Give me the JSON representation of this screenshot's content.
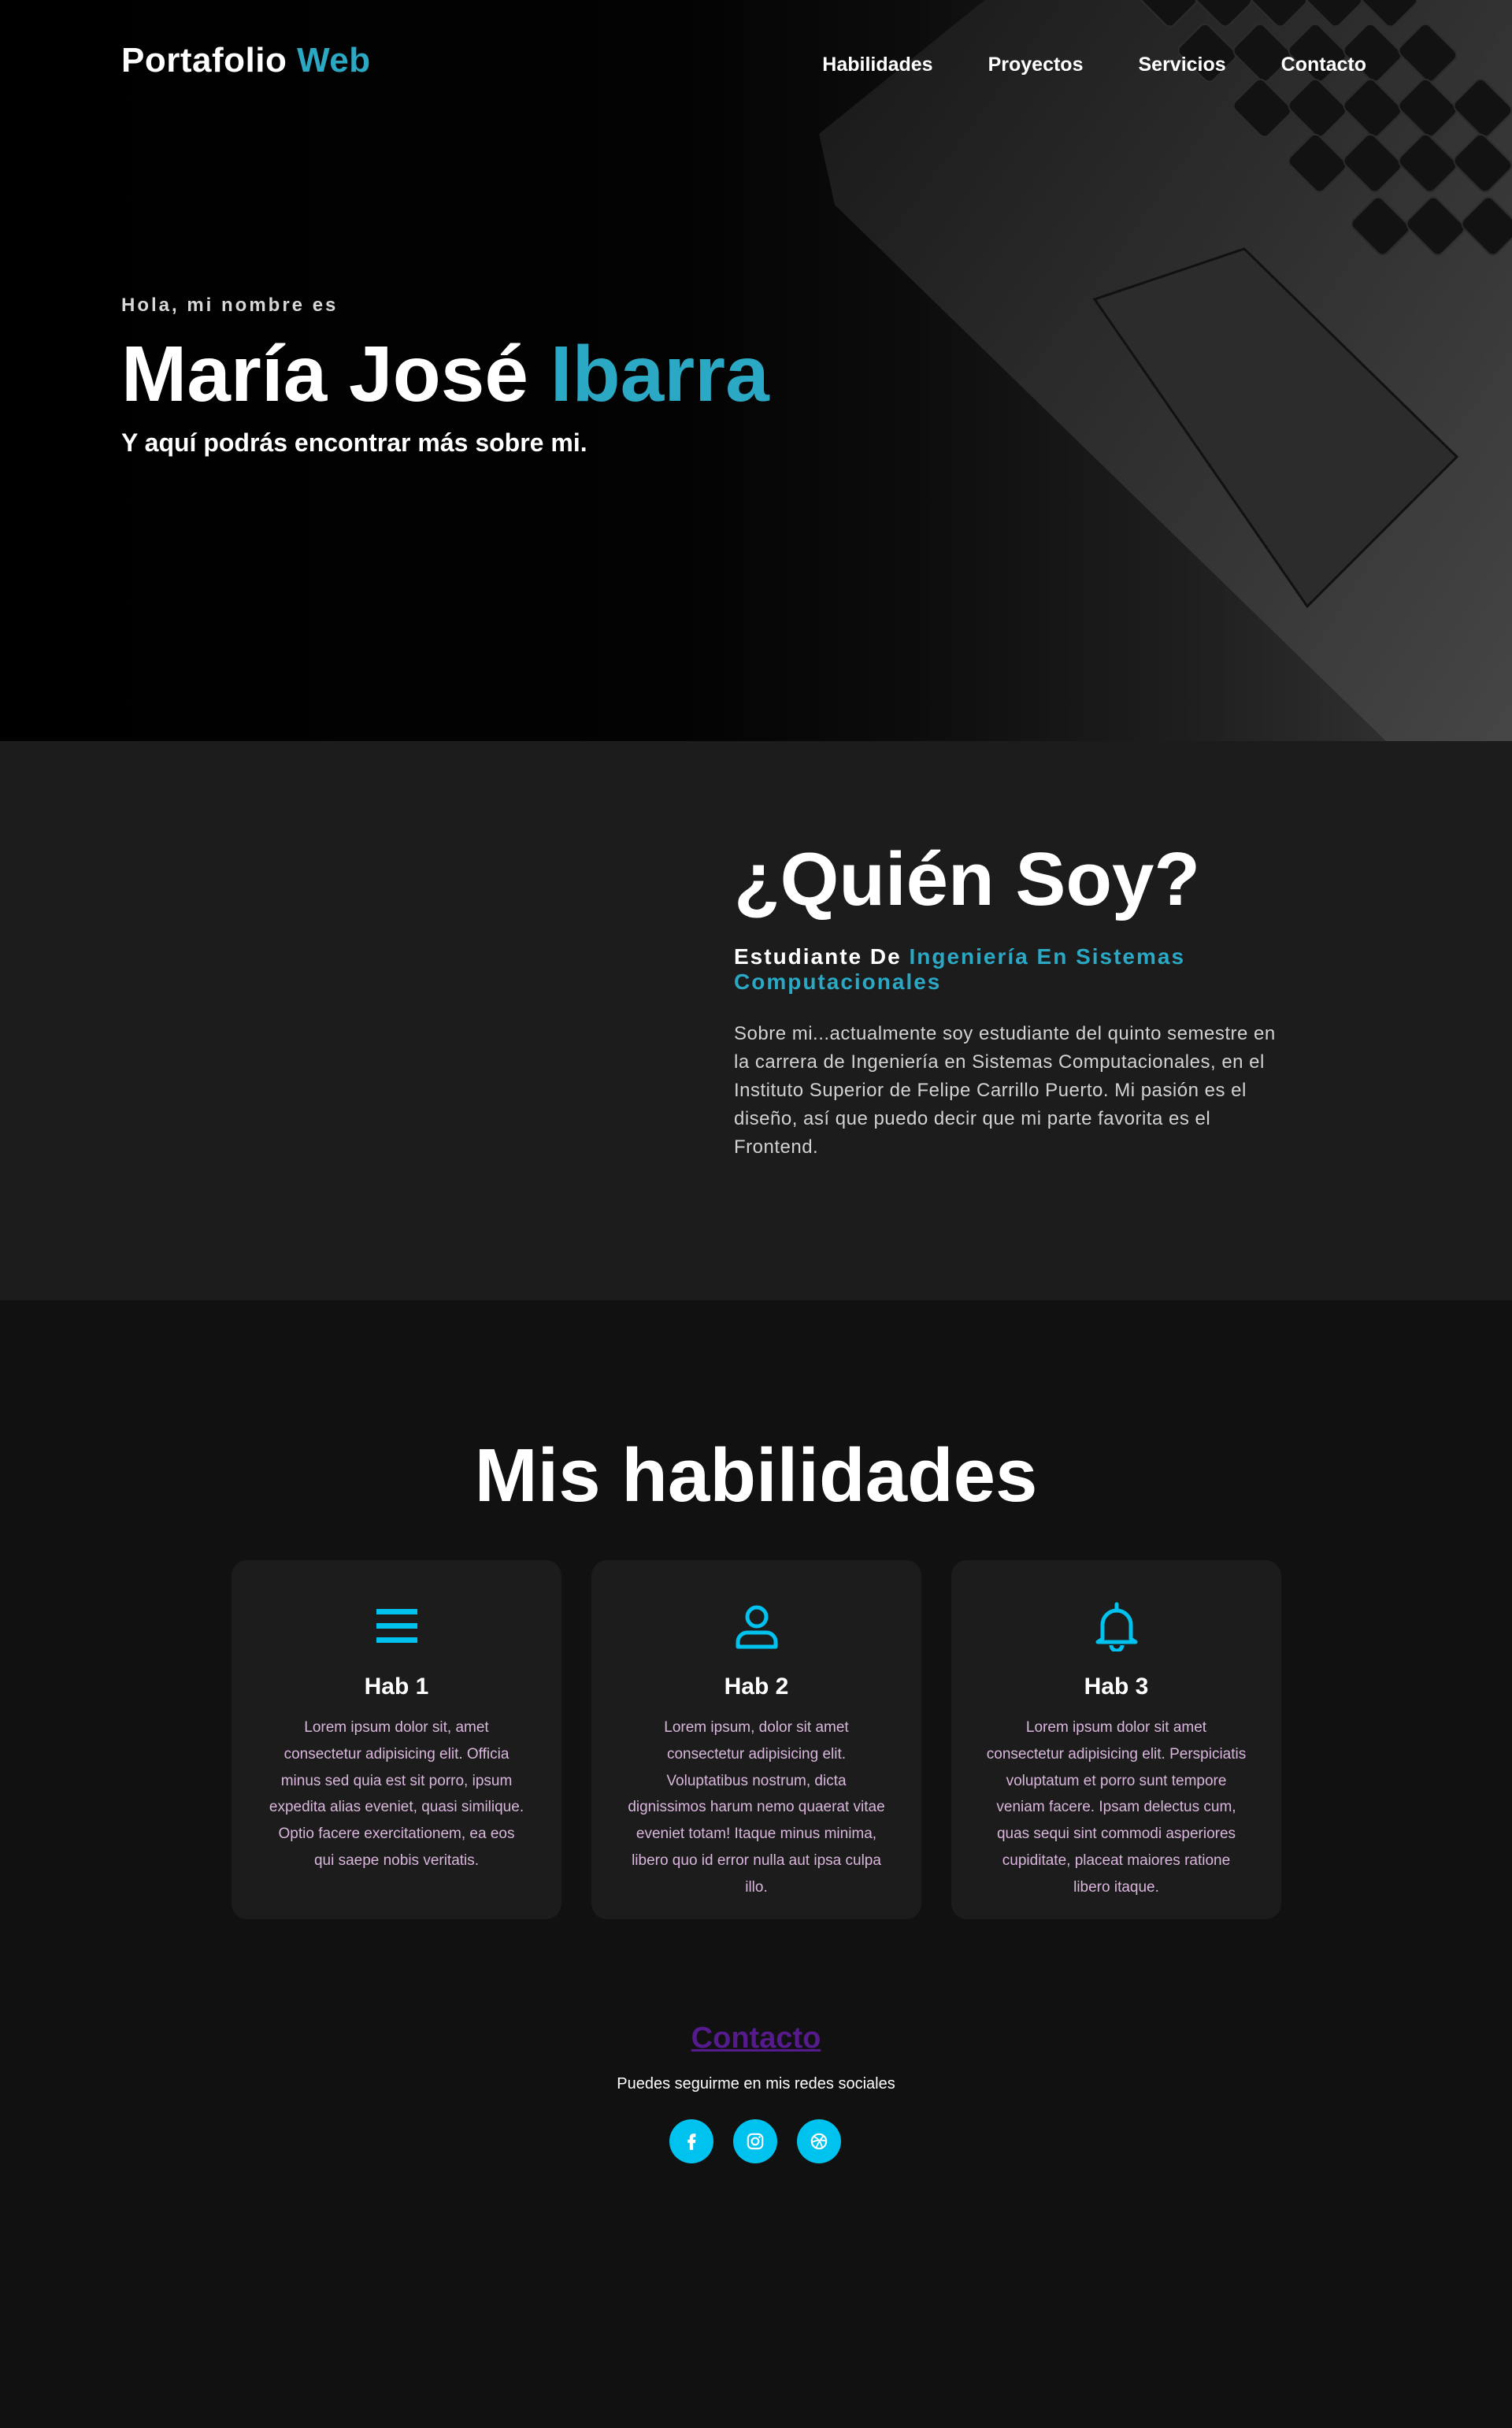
{
  "header": {
    "logo_text": "Portafolio",
    "logo_accent": "Web",
    "nav": [
      "Habilidades",
      "Proyectos",
      "Servicios",
      "Contacto"
    ]
  },
  "hero": {
    "greeting": "Hola, mi nombre es",
    "name_first": "María José",
    "name_accent": "Ibarra",
    "tagline": "Y aquí podrás encontrar más sobre mi."
  },
  "about": {
    "title": "¿Quién Soy?",
    "subtitle_prefix": "Estudiante De",
    "subtitle_accent": "Ingeniería En Sistemas Computacionales",
    "text": "Sobre mi...actualmente soy estudiante del quinto semestre en la carrera de Ingeniería en Sistemas Computacionales, en el Instituto Superior de Felipe Carrillo Puerto. Mi pasión es el diseño, así que puedo decir que mi parte favorita es el Frontend."
  },
  "skills": {
    "title": "Mis habilidades",
    "cards": [
      {
        "icon": "menu-icon",
        "title": "Hab 1",
        "text": "Lorem ipsum dolor sit, amet consectetur adipisicing elit. Officia minus sed quia est sit porro, ipsum expedita alias eveniet, quasi similique. Optio facere exercitationem, ea eos qui saepe nobis veritatis."
      },
      {
        "icon": "user-icon",
        "title": "Hab 2",
        "text": "Lorem ipsum, dolor sit amet consectetur adipisicing elit. Voluptatibus nostrum, dicta dignissimos harum nemo quaerat vitae eveniet totam! Itaque minus minima, libero quo id error nulla aut ipsa culpa illo."
      },
      {
        "icon": "bell-icon",
        "title": "Hab 3",
        "text": "Lorem ipsum dolor sit amet consectetur adipisicing elit. Perspiciatis voluptatum et porro sunt tempore veniam facere. Ipsam delectus cum, quas sequi sint commodi asperiores cupiditate, placeat maiores ratione libero itaque."
      }
    ]
  },
  "contact": {
    "title": "Contacto",
    "subtitle": "Puedes seguirme en mis redes sociales",
    "socials": [
      "facebook-icon",
      "instagram-icon",
      "dribbble-icon"
    ]
  },
  "colors": {
    "accent": "#2aa8c4",
    "icon_cyan": "#00c2ee",
    "card_text": "#d9b6dc",
    "contact_link": "#551a8b",
    "hero_bg": "#000000",
    "about_bg": "#1c1c1c",
    "page_bg": "#111111"
  }
}
